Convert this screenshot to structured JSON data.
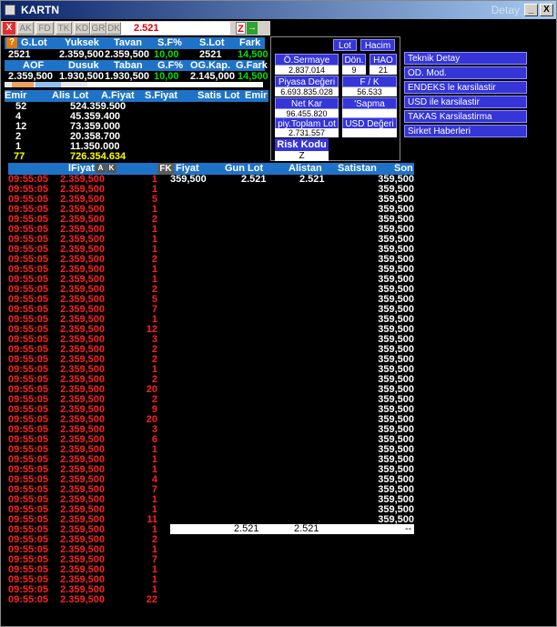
{
  "window": {
    "title": "KARTN",
    "detail": "Detay",
    "minimize": "_",
    "close": "X"
  },
  "toolbar": {
    "close": "X",
    "buttons": [
      "AK",
      "FD",
      "TK",
      "KD",
      "GR",
      "DK"
    ],
    "value": "2.521",
    "z": "Z",
    "go": "→"
  },
  "summary": {
    "headers1": [
      "G.Lot",
      "Yuksek",
      "Tavan",
      "S.F%",
      "S.Lot",
      "Fark"
    ],
    "values1": [
      "2521",
      "2.359,500",
      "2.359,500",
      "10,00",
      "2521",
      "14,500"
    ],
    "headers2": [
      "AOF",
      "Dusuk",
      "Taban",
      "G.F%",
      "OG.Kap.",
      "G.Fark"
    ],
    "values2": [
      "2.359,500",
      "1.930,500",
      "1.930,500",
      "10,00",
      "2.145,000",
      "14,500"
    ],
    "progress_percent": 32
  },
  "depth": {
    "headers": [
      "Emir",
      "Alis Lot",
      "A.Fiyat",
      "S.Fiyat",
      "Satis Lot",
      "Emir"
    ],
    "rows": [
      {
        "emir": "52",
        "lot": "524.359.500"
      },
      {
        "emir": "4",
        "lot": "45.359.400"
      },
      {
        "emir": "12",
        "lot": "73.359.000"
      },
      {
        "emir": "2",
        "lot": "20.358.700"
      },
      {
        "emir": "1",
        "lot": "11.350.000"
      }
    ],
    "total": {
      "emir": "77",
      "lot": "726.354.634"
    }
  },
  "panel": {
    "lot": "Lot",
    "hacim": "Hacim",
    "sermaye_label": "Ö.Sermaye",
    "sermaye_value": "2.837.014",
    "don_label": "Dön.",
    "don_value": "9",
    "hao_label": "HAO",
    "hao_value": "21",
    "piyasa_label": "Piyasa Değeri",
    "piyasa_value": "6.693.835.028",
    "fk_label": "F / K",
    "fk_value": "56.533",
    "netkar_label": "Net Kar",
    "netkar_value": "96.455.820",
    "sapma_label": "'Sapma",
    "sapma_value": "",
    "toplam_label": "piy.Toplam Lot",
    "toplam_value": "2.731.557",
    "usd_label": "USD Değeri",
    "usd_value": "",
    "risk_label": "Risk Kodu",
    "risk_value": "Z"
  },
  "right_menu": [
    "Teknik Detay",
    "OD. Mod.",
    "ENDEKS le karsilastir",
    "USD ile karsilastir",
    "TAKAS Karsilastirma",
    "Sirket Haberleri"
  ],
  "trades": {
    "headers": [
      "lFiyat",
      "A",
      "K",
      "FK",
      "Fiyat",
      "Gun Lot",
      "Alistan",
      "Satistan",
      "Son"
    ],
    "first": {
      "fiyat": "359,500",
      "gunlot": "2.521",
      "alistan": "2.521"
    },
    "time": "09:55:05",
    "price": "2.359,500",
    "lots": [
      "1",
      "1",
      "5",
      "1",
      "2",
      "1",
      "1",
      "1",
      "2",
      "1",
      "1",
      "2",
      "5",
      "7",
      "1",
      "12",
      "3",
      "2",
      "2",
      "1",
      "2",
      "20",
      "2",
      "9",
      "20",
      "3",
      "6",
      "1",
      "1",
      "1",
      "4",
      "7",
      "1",
      "1",
      "11",
      "1",
      "2",
      "1",
      "7",
      "1",
      "1",
      "1",
      "22"
    ],
    "son_value": "359,500",
    "son_count": 35,
    "summary_line": {
      "lot": "2.521",
      "alistan": "2.521",
      "dash": "--"
    }
  },
  "colors": {
    "red": "#ff2020",
    "header_blue": "#1e73c8",
    "button_blue": "#3535d8",
    "green": "#00e000"
  }
}
